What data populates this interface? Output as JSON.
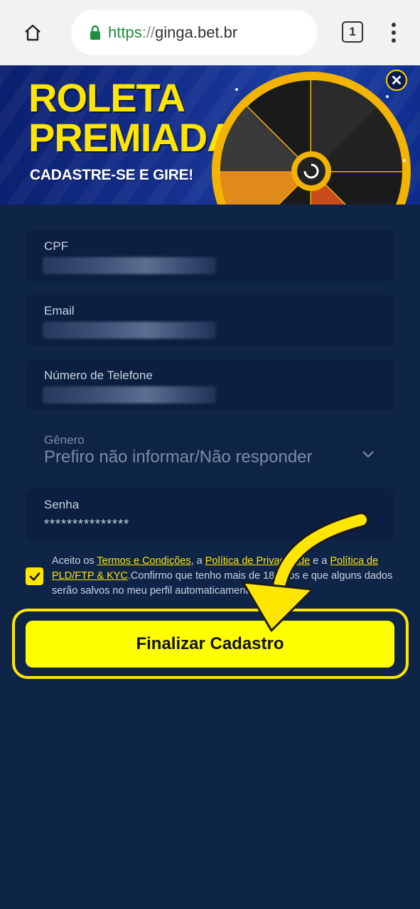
{
  "browser": {
    "url_scheme": "https",
    "url_sep": "://",
    "url_host": "ginga.bet.br",
    "tab_count": "1"
  },
  "banner": {
    "title_line1": "ROLETA",
    "title_line2": "PREMIADA",
    "subtitle": "CADASTRE-SE E GIRE!",
    "close_label": "✕"
  },
  "form": {
    "cpf_label": "CPF",
    "email_label": "Email",
    "phone_label": "Número de Telefone",
    "gender_label": "Gênero",
    "gender_value": "Prefiro não informar/Não responder",
    "password_label": "Senha",
    "password_value": "***************"
  },
  "terms": {
    "text_1": "Aceito os ",
    "link_terms": "Termos e Condições",
    "text_2": ", a ",
    "link_privacy": "Política de Privacidade",
    "text_3": " e a ",
    "link_pld": "Política de PLD/FTP & KYC",
    "text_4": ".Confirmo que tenho mais de 18 anos e que alguns dados serão salvos no meu perfil automaticamente.",
    "checked": true
  },
  "submit": {
    "label": "Finalizar Cadastro"
  },
  "colors": {
    "background": "#0f2548",
    "field_bg": "#0b1f40",
    "accent": "#ffff00"
  }
}
